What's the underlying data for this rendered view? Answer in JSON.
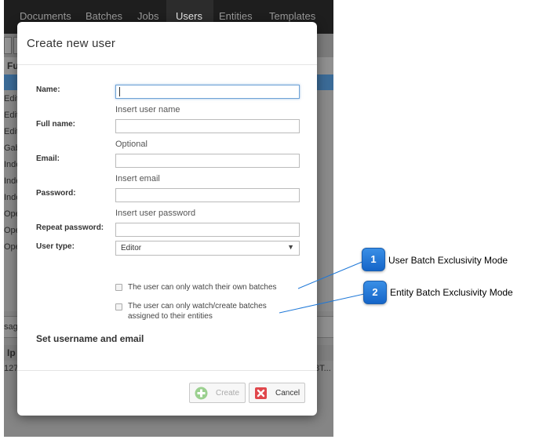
{
  "app": {
    "nav": [
      "Documents",
      "Batches",
      "Jobs",
      "Users",
      "Entities",
      "Templates"
    ],
    "active_nav": "Users",
    "list_header": "Fu",
    "rows": [
      "Edit",
      "Edit",
      "Edit",
      "Gab",
      "Inde",
      "Inde",
      "Inde",
      "Ope",
      "Ope",
      "Ope"
    ],
    "lower_tab": "sag",
    "lower_col": "Ip",
    "lower_cell_left": "127",
    "lower_cell_right": "8T..."
  },
  "dialog": {
    "title": "Create new user",
    "fields": {
      "name": {
        "label": "Name:",
        "value": "",
        "help": "Insert user name"
      },
      "full_name": {
        "label": "Full name:",
        "value": "",
        "help": "Optional"
      },
      "email": {
        "label": "Email:",
        "value": "",
        "help": "Insert email"
      },
      "password": {
        "label": "Password:",
        "value": "",
        "help": "Insert user password"
      },
      "repeat_password": {
        "label": "Repeat password:",
        "value": ""
      },
      "user_type": {
        "label": "User type:",
        "value": "Editor"
      }
    },
    "checkboxes": [
      {
        "label": "The user can only watch their own batches",
        "checked": false
      },
      {
        "label": "The user can only watch/create batches assigned to their entities",
        "checked": false
      }
    ],
    "section_title": "Set username and email",
    "buttons": {
      "create": "Create",
      "cancel": "Cancel"
    }
  },
  "callouts": [
    {
      "number": "1",
      "text": "User Batch Exclusivity Mode"
    },
    {
      "number": "2",
      "text": "Entity Batch Exclusivity Mode"
    }
  ],
  "colors": {
    "accent_blue": "#1e78d8",
    "create_icon": "#9bd08f",
    "cancel_icon": "#e0474c"
  },
  "icons": {
    "create": "plus-circle-icon",
    "cancel": "close-box-icon",
    "dropdown": "triangle-down-icon"
  }
}
